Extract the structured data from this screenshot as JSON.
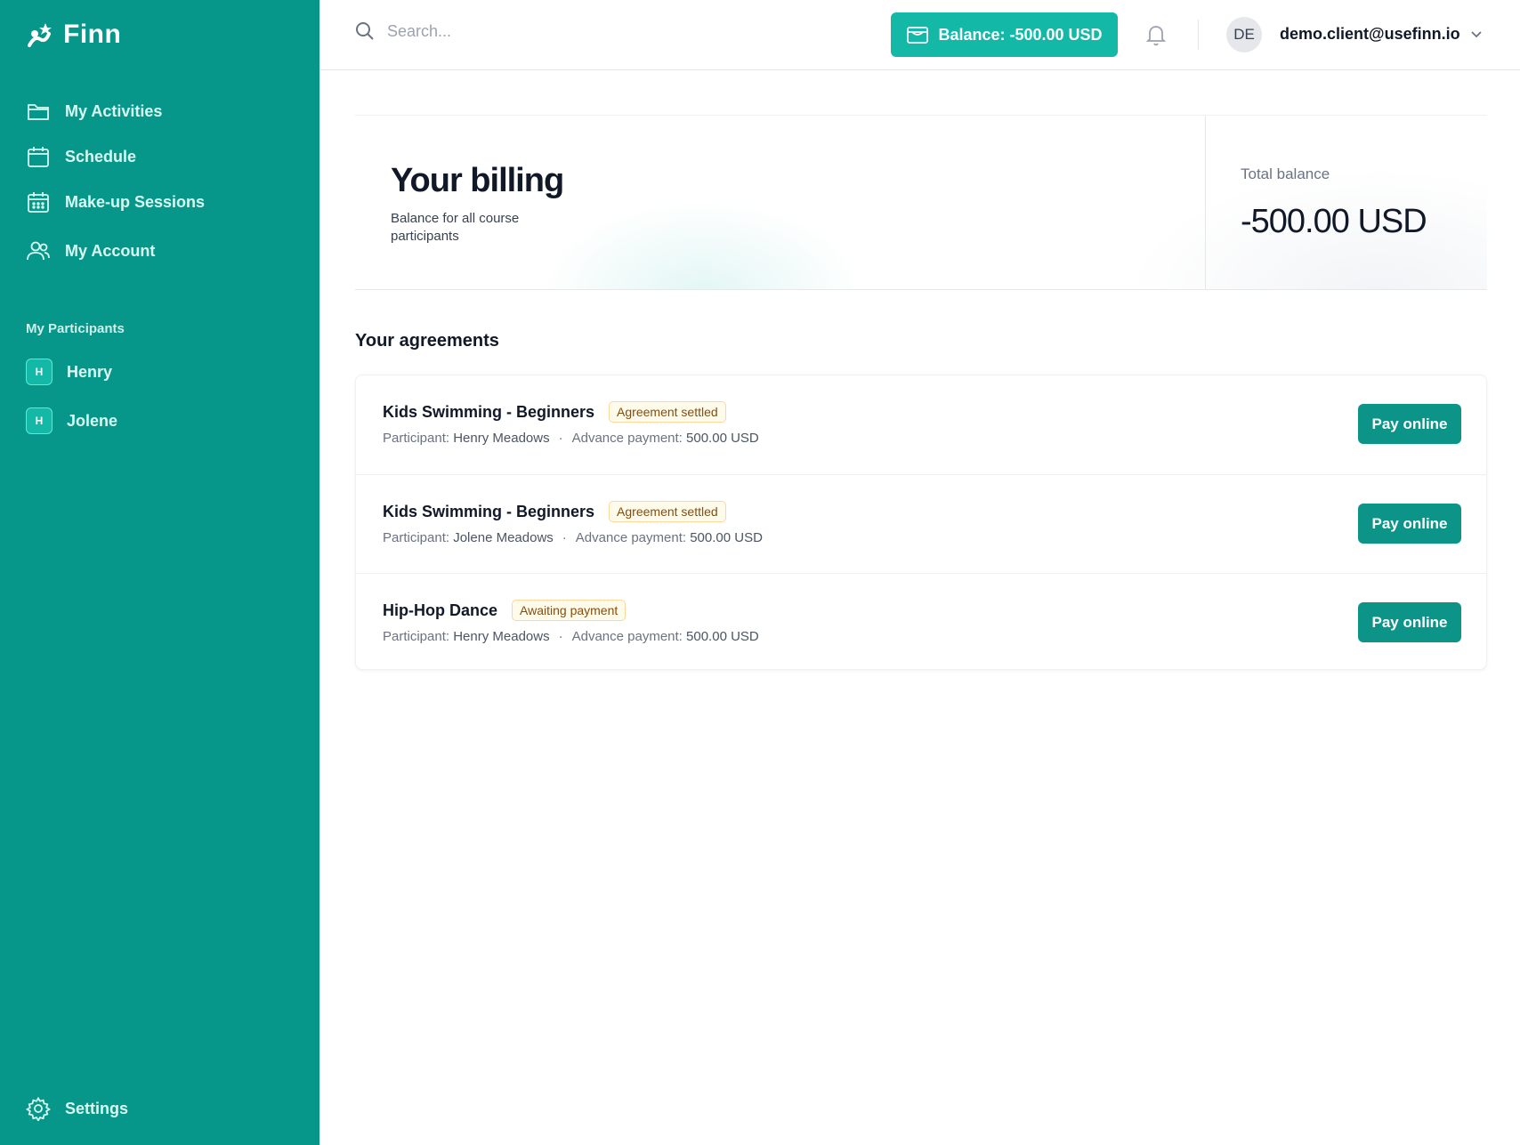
{
  "brand": {
    "name": "Finn"
  },
  "sidebar": {
    "items": [
      {
        "label": "My Activities",
        "icon": "folder-icon"
      },
      {
        "label": "Schedule",
        "icon": "calendar-icon"
      },
      {
        "label": "Make-up Sessions",
        "icon": "calendar-grid-icon"
      },
      {
        "label": "My Account",
        "icon": "users-icon"
      }
    ],
    "participants_heading": "My Participants",
    "participants": [
      {
        "initial": "H",
        "name": "Henry"
      },
      {
        "initial": "H",
        "name": "Jolene"
      }
    ],
    "settings_label": "Settings"
  },
  "header": {
    "search_placeholder": "Search...",
    "balance_label": "Balance: -500.00 USD",
    "user_initials": "DE",
    "user_email": "demo.client@usefinn.io"
  },
  "billing": {
    "title": "Your billing",
    "subtitle": "Balance for all course participants",
    "total_label": "Total balance",
    "total_value": "-500.00 USD"
  },
  "agreements": {
    "title": "Your agreements",
    "participant_prefix": "Participant:",
    "advance_prefix": "Advance payment:",
    "pay_label": "Pay online",
    "rows": [
      {
        "course": "Kids Swimming - Beginners",
        "status": "Agreement settled",
        "participant": "Henry Meadows",
        "advance": "500.00 USD"
      },
      {
        "course": "Kids Swimming - Beginners",
        "status": "Agreement settled",
        "participant": "Jolene Meadows",
        "advance": "500.00 USD"
      },
      {
        "course": "Hip-Hop Dance",
        "status": "Awaiting payment",
        "participant": "Henry Meadows",
        "advance": "500.00 USD"
      }
    ]
  },
  "colors": {
    "sidebar": "#07968a",
    "accent": "#14b8a6",
    "button": "#0d9488",
    "badge_bg": "#fffbeb",
    "badge_text": "#854d0e"
  }
}
